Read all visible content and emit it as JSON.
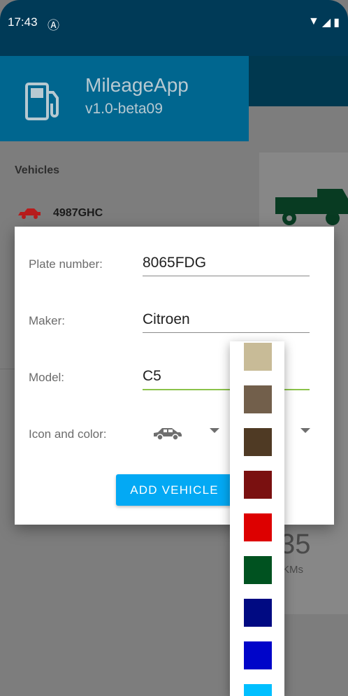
{
  "status_bar": {
    "time": "17:43"
  },
  "drawer": {
    "app_name": "MileageApp",
    "version": "v1.0-beta09",
    "section_title": "Vehicles",
    "vehicles": [
      {
        "label": "4987GHC",
        "color": "#b71c1c"
      }
    ]
  },
  "background_card": {
    "number": "35",
    "unit": "KMs"
  },
  "dialog": {
    "plate": {
      "label": "Plate number:",
      "value": "8065FDG"
    },
    "maker": {
      "label": "Maker:",
      "value": "Citroen"
    },
    "model": {
      "label": "Model:",
      "value": "C5"
    },
    "icon_color": {
      "label": "Icon and color:",
      "icon": "car-icon"
    },
    "add_button": "ADD VEHICLE"
  },
  "color_options": [
    "#c8bb97",
    "#725f4b",
    "#4f3a24",
    "#7a1010",
    "#dd0000",
    "#005220",
    "#000a82",
    "#0005c9",
    "#00bfff"
  ],
  "colors": {
    "accent": "#03a9f4",
    "drawer_header": "#00668f",
    "focus_line": "#8bc34a"
  }
}
